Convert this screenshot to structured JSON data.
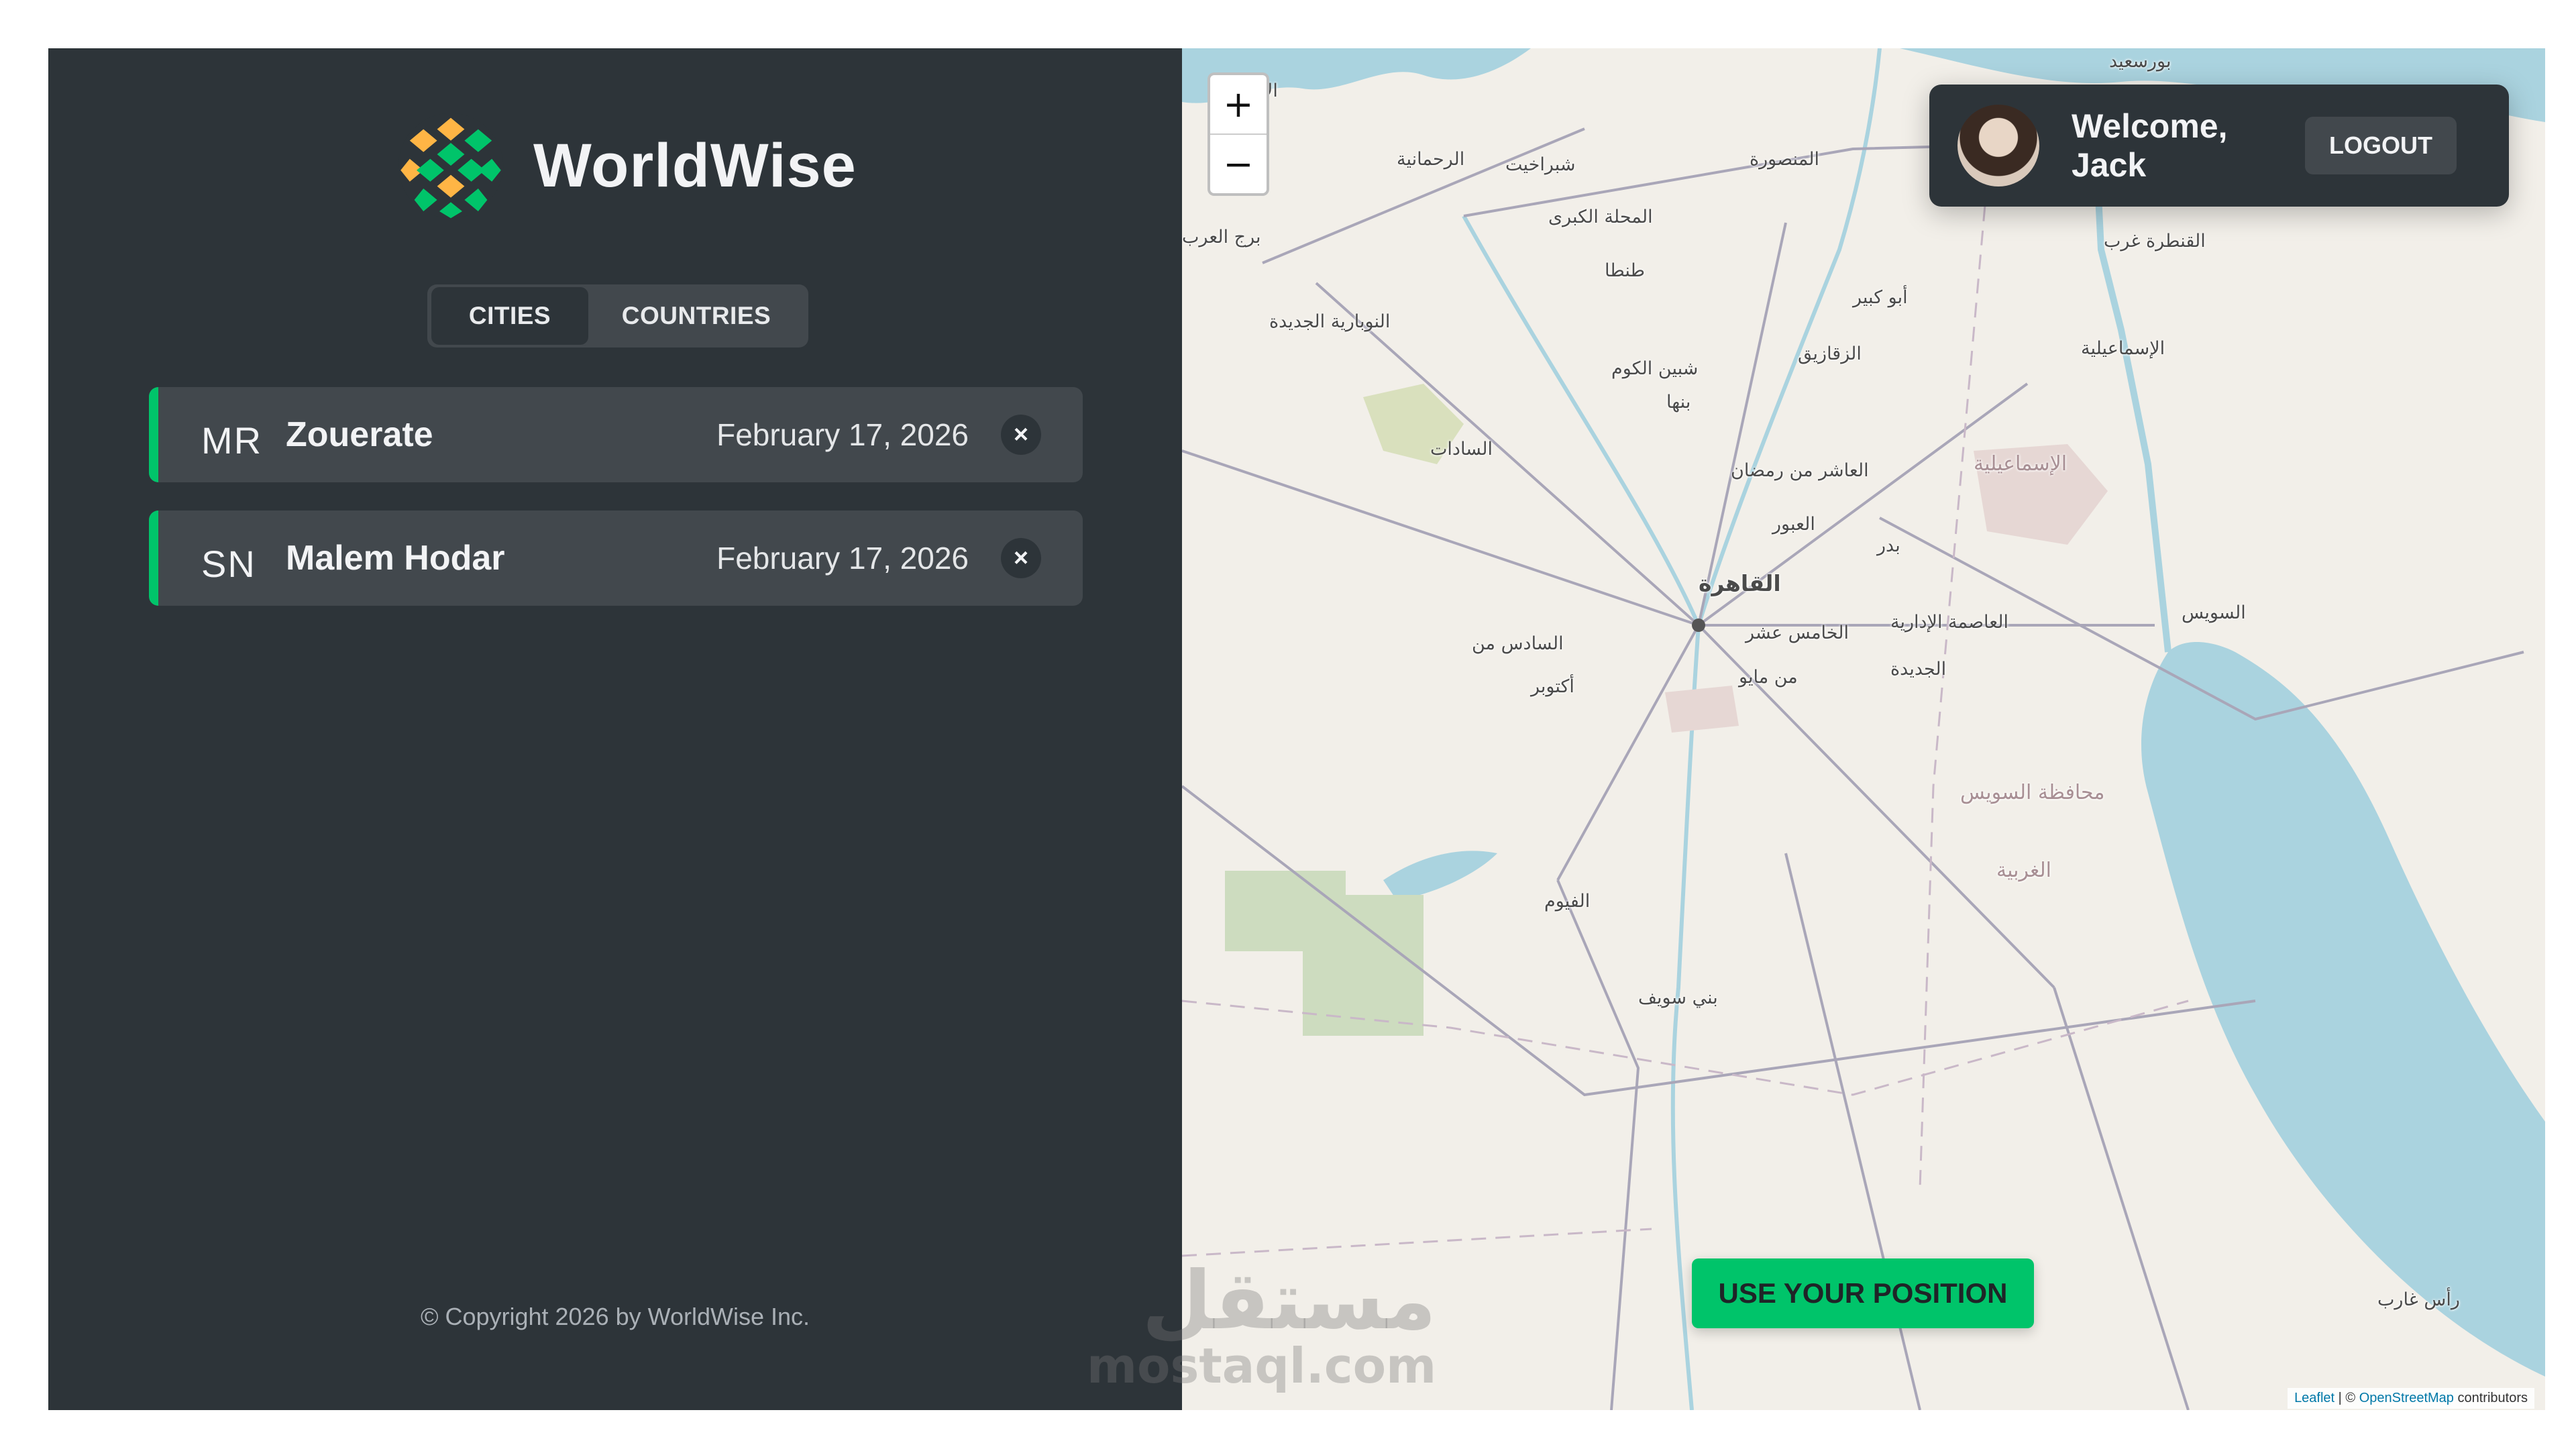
{
  "app": {
    "name": "WorldWise",
    "footer": "© Copyright 2026 by WorldWise Inc."
  },
  "tabs": [
    {
      "label": "CITIES",
      "active": true
    },
    {
      "label": "COUNTRIES",
      "active": false
    }
  ],
  "cities": [
    {
      "code": "MR",
      "name": "Zouerate",
      "date": "February 17, 2026",
      "delete": "×"
    },
    {
      "code": "SN",
      "name": "Malem Hodar",
      "date": "February 17, 2026",
      "delete": "×"
    }
  ],
  "map": {
    "zoom_in": "+",
    "zoom_out": "−",
    "use_position": "USE YOUR POSITION",
    "attribution": {
      "leaflet": "Leaflet",
      "sep": " | © ",
      "osm": "OpenStreetMap",
      "tail": " contributors"
    },
    "labels": [
      "بورسعيد",
      "الإ",
      "الرحمانية",
      "شبراخيت",
      "المنصورة",
      "المحلة الكبرى",
      "برج العرب",
      "طنطا",
      "أبو كبير",
      "القنطرة غرب",
      "النوبارية الجديدة",
      "الزقازيق",
      "الإسماعيلية",
      "شبين الكوم",
      "بنها",
      "السادات",
      "العاشر من رمضان",
      "الإسماعيلية",
      "العبور",
      "بدر",
      "القاهرة",
      "السادس من",
      "الخامس عشر",
      "العاصمة الإدارية",
      "السويس",
      "أكتوبر",
      "من مايو",
      "الجديدة",
      "محافظة السويس",
      "الغربية",
      "الفيوم",
      "بني سويف",
      "رأس غارب"
    ]
  },
  "user": {
    "welcome": "Welcome, Jack",
    "logout": "LOGOUT"
  },
  "watermark": {
    "ar": "مستقل",
    "en": "mostaql.com"
  },
  "colors": {
    "sidebar": "#2d3439",
    "card": "#42484d",
    "accent": "#00c46a",
    "text": "#f2f3f5"
  }
}
